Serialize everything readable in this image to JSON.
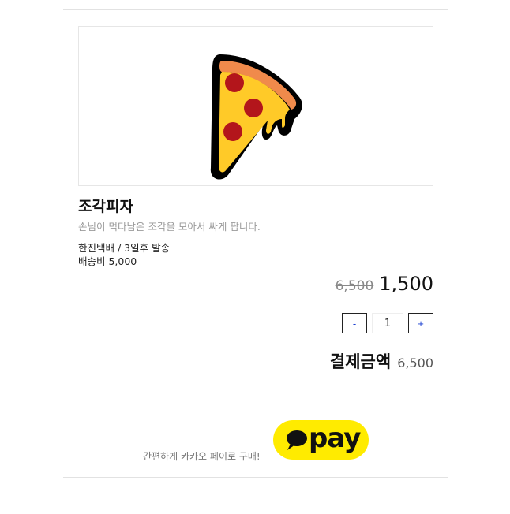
{
  "product": {
    "image_icon": "pizza-slice-icon",
    "name": "조각피자",
    "description": "손님이 먹다남은 조각을 모아서 싸게 팝니다.",
    "shipping": "한진택배 / 3일후 발송",
    "shipping_fee": "배송비 5,000",
    "original_price": "6,500",
    "sale_price": "1,500"
  },
  "quantity": {
    "minus_label": "-",
    "value": "1",
    "plus_label": "+"
  },
  "total": {
    "label": "결제금액",
    "value": "6,500"
  },
  "payment": {
    "caption": "간편하게 카카오 페이로 구매!",
    "button_text": "pay",
    "button_icon": "speech-bubble-icon",
    "brand_color": "#ffeb00"
  }
}
